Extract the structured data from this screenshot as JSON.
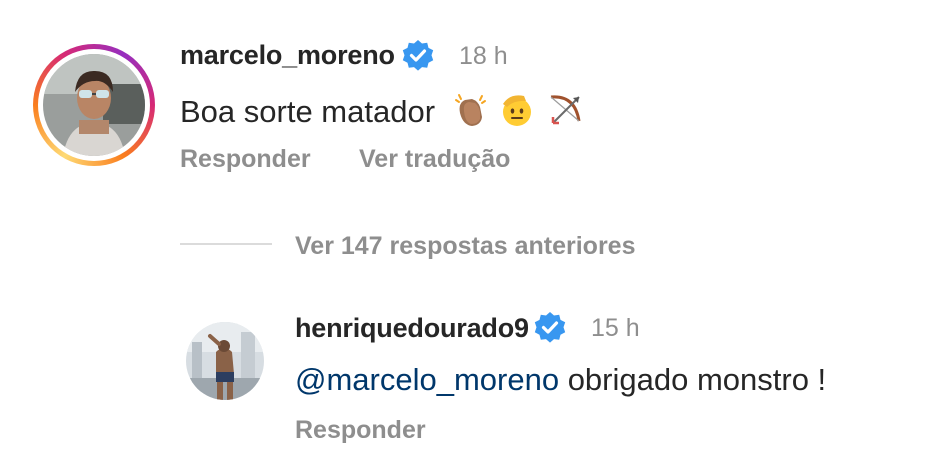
{
  "comment1": {
    "username": "marcelo_moreno",
    "verified_icon": "verified-badge-icon",
    "time": "18 h",
    "text": "Boa sorte matador",
    "emojis": [
      "clapping-hands",
      "saluting-face",
      "bow-and-arrow"
    ],
    "actions": {
      "reply": "Responder",
      "translate": "Ver tradução"
    }
  },
  "replies": {
    "view_previous": "Ver 147 respostas anteriores"
  },
  "reply1": {
    "username": "henriquedourado9",
    "verified_icon": "verified-badge-icon",
    "time": "15 h",
    "mention": "@marcelo_moreno",
    "text": " obrigado monstro !",
    "actions": {
      "reply": "Responder"
    }
  },
  "colors": {
    "verified_blue": "#3897f0",
    "secondary_text": "#8e8e8e",
    "mention_link": "#00376b"
  }
}
